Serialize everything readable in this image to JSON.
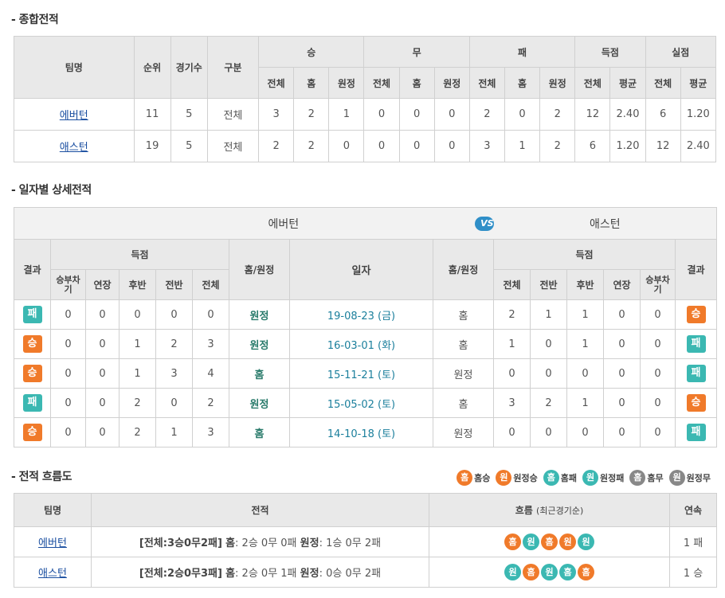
{
  "sections": {
    "overall": "- 종합전적",
    "daily": "- 일자별 상세전적",
    "flow": "- 전적 흐름도"
  },
  "overall_table": {
    "headers": {
      "team": "팀명",
      "rank": "순위",
      "games": "경기수",
      "type": "구분",
      "win": "승",
      "draw": "무",
      "loss": "패",
      "scored": "득점",
      "conceded": "실점",
      "total": "전체",
      "home": "홈",
      "away": "원정",
      "avg": "평균"
    },
    "rows": [
      {
        "team": "에버턴",
        "rank": "11",
        "games": "5",
        "type": "전체",
        "w_t": "3",
        "w_h": "2",
        "w_a": "1",
        "d_t": "0",
        "d_h": "0",
        "d_a": "0",
        "l_t": "2",
        "l_h": "0",
        "l_a": "2",
        "s_t": "12",
        "s_avg": "2.40",
        "c_t": "6",
        "c_avg": "1.20"
      },
      {
        "team": "애스턴",
        "rank": "19",
        "games": "5",
        "type": "전체",
        "w_t": "2",
        "w_h": "2",
        "w_a": "0",
        "d_t": "0",
        "d_h": "0",
        "d_a": "0",
        "l_t": "3",
        "l_h": "1",
        "l_a": "2",
        "s_t": "6",
        "s_avg": "1.20",
        "c_t": "12",
        "c_avg": "2.40"
      }
    ]
  },
  "daily_table": {
    "home_team": "에버턴",
    "vs": "VS",
    "away_team": "애스턴",
    "headers": {
      "result": "결과",
      "score": "득점",
      "pk": "승부차기",
      "et": "연장",
      "h2": "후반",
      "h1": "전반",
      "total": "전체",
      "venue": "홈/원정",
      "date": "일자"
    },
    "rows": [
      {
        "l_result": "패",
        "l_pk": "0",
        "l_et": "0",
        "l_h2": "0",
        "l_h1": "0",
        "l_tot": "0",
        "l_venue": "원정",
        "date": "19-08-23 (금)",
        "r_venue": "홈",
        "r_tot": "2",
        "r_h1": "1",
        "r_h2": "1",
        "r_et": "0",
        "r_pk": "0",
        "r_result": "승"
      },
      {
        "l_result": "승",
        "l_pk": "0",
        "l_et": "0",
        "l_h2": "1",
        "l_h1": "2",
        "l_tot": "3",
        "l_venue": "원정",
        "date": "16-03-01 (화)",
        "r_venue": "홈",
        "r_tot": "1",
        "r_h1": "0",
        "r_h2": "1",
        "r_et": "0",
        "r_pk": "0",
        "r_result": "패"
      },
      {
        "l_result": "승",
        "l_pk": "0",
        "l_et": "0",
        "l_h2": "1",
        "l_h1": "3",
        "l_tot": "4",
        "l_venue": "홈",
        "date": "15-11-21 (토)",
        "r_venue": "원정",
        "r_tot": "0",
        "r_h1": "0",
        "r_h2": "0",
        "r_et": "0",
        "r_pk": "0",
        "r_result": "패"
      },
      {
        "l_result": "패",
        "l_pk": "0",
        "l_et": "0",
        "l_h2": "2",
        "l_h1": "0",
        "l_tot": "2",
        "l_venue": "원정",
        "date": "15-05-02 (토)",
        "r_venue": "홈",
        "r_tot": "3",
        "r_h1": "2",
        "r_h2": "1",
        "r_et": "0",
        "r_pk": "0",
        "r_result": "승"
      },
      {
        "l_result": "승",
        "l_pk": "0",
        "l_et": "0",
        "l_h2": "2",
        "l_h1": "1",
        "l_tot": "3",
        "l_venue": "홈",
        "date": "14-10-18 (토)",
        "r_venue": "원정",
        "r_tot": "0",
        "r_h1": "0",
        "r_h2": "0",
        "r_et": "0",
        "r_pk": "0",
        "r_result": "패"
      }
    ]
  },
  "legend": [
    {
      "glyph": "홈",
      "label": "홈승",
      "kind": "hw"
    },
    {
      "glyph": "원",
      "label": "원정승",
      "kind": "aw"
    },
    {
      "glyph": "홈",
      "label": "홈패",
      "kind": "hl"
    },
    {
      "glyph": "원",
      "label": "원정패",
      "kind": "al"
    },
    {
      "glyph": "홈",
      "label": "홈무",
      "kind": "hd"
    },
    {
      "glyph": "원",
      "label": "원정무",
      "kind": "ad"
    }
  ],
  "flow_table": {
    "headers": {
      "team": "팀명",
      "record": "전적",
      "flow": "흐름",
      "flow_note": "(최근경기순)",
      "streak": "연속"
    },
    "rows": [
      {
        "team": "에버턴",
        "summary": "[전체:3승0무2패]",
        "home_label": "홈",
        "home_rec": ": 2승 0무 0패",
        "away_label": "원정",
        "away_rec": ": 1승 0무 2패",
        "flow": [
          {
            "g": "홈",
            "k": "hw"
          },
          {
            "g": "원",
            "k": "al"
          },
          {
            "g": "홈",
            "k": "hw"
          },
          {
            "g": "원",
            "k": "aw"
          },
          {
            "g": "원",
            "k": "al"
          }
        ],
        "streak": "1 패"
      },
      {
        "team": "애스턴",
        "summary": "[전체:2승0무3패]",
        "home_label": "홈",
        "home_rec": ": 2승 0무 1패",
        "away_label": "원정",
        "away_rec": ": 0승 0무 2패",
        "flow": [
          {
            "g": "원",
            "k": "al"
          },
          {
            "g": "홈",
            "k": "hw"
          },
          {
            "g": "원",
            "k": "al"
          },
          {
            "g": "홈",
            "k": "hl"
          },
          {
            "g": "홈",
            "k": "hw"
          }
        ],
        "streak": "1 승"
      }
    ]
  }
}
